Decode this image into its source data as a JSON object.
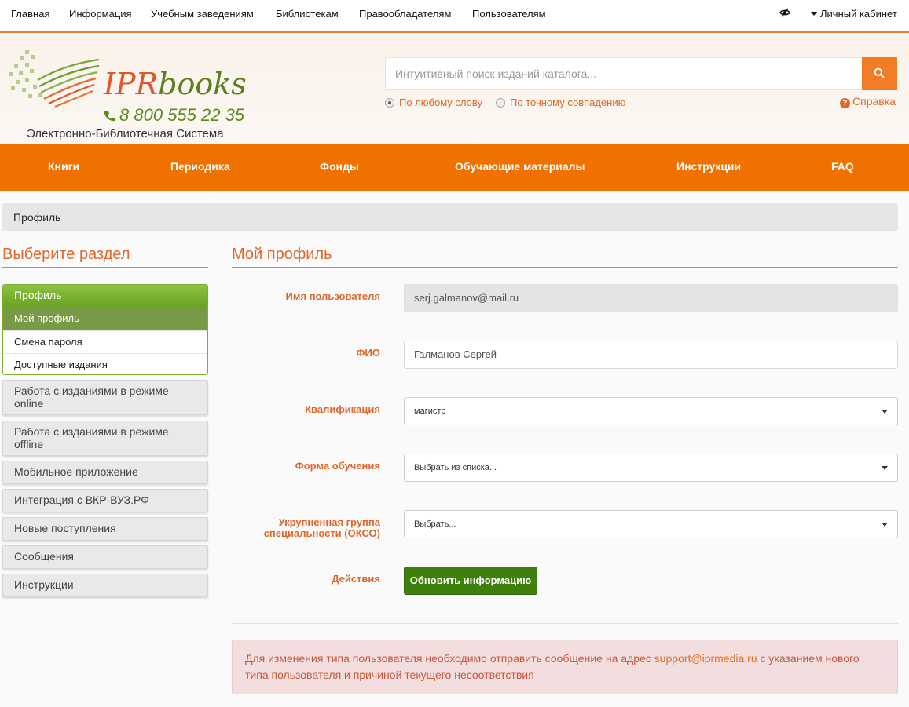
{
  "topnav": {
    "items": [
      "Главная",
      "Информация",
      "Учебным заведениям",
      "Библиотекам",
      "Правообладателям",
      "Пользователям"
    ],
    "eye_icon": "eye-slash-icon",
    "cabinet": "Личный кабинет"
  },
  "logo": {
    "brand_ipr": "IPR",
    "brand_books": "books",
    "phone": "8 800 555 22 35",
    "subtitle": "Электронно-Библиотечная Система"
  },
  "search": {
    "placeholder": "Интуитивный поиск изданий каталога...",
    "option_any": "По любому слову",
    "option_exact": "По точному совпадению",
    "help": "Справка"
  },
  "mainmenu": [
    "Книги",
    "Периодика",
    "Фонды",
    "Обучающие материалы",
    "Инструкции",
    "FAQ"
  ],
  "breadcrumb": "Профиль",
  "sidebar": {
    "title": "Выберите раздел",
    "group_head": "Профиль",
    "group_items": [
      "Мой профиль",
      "Смена пароля",
      "Доступные издания"
    ],
    "items": [
      "Работа с изданиями в режиме online",
      "Работа с изданиями в режиме offline",
      "Мобильное приложение",
      "Интеграция с ВКР-ВУЗ.РФ",
      "Новые поступления",
      "Сообщения",
      "Инструкции"
    ]
  },
  "profile": {
    "title": "Мой профиль",
    "username_label": "Имя пользователя",
    "username_value": "serj.galmanov@mail.ru",
    "fio_label": "ФИО",
    "fio_value": "Галманов Сергей",
    "qualification_label": "Квалификация",
    "qualification_value": "магистр",
    "study_form_label": "Форма обучения",
    "study_form_value": "Выбрать из списка...",
    "okso_label_1": "Укрупненная группа",
    "okso_label_2": "специальности (ОКСО)",
    "okso_value": "Выбрать...",
    "actions_label": "Действия",
    "update_button": "Обновить информацию"
  },
  "alert": {
    "text_before": "Для изменения типа пользователя необходимо отправить сообщение на адрес ",
    "email": "support@iprmedia.ru",
    "text_after": " с указанием нового типа пользователя и причиной текущего несоответствия"
  },
  "colors": {
    "accent_orange": "#f07000",
    "label_orange": "#e0672a",
    "green": "#3f7f0c",
    "sidebar_active": "#789a46"
  }
}
